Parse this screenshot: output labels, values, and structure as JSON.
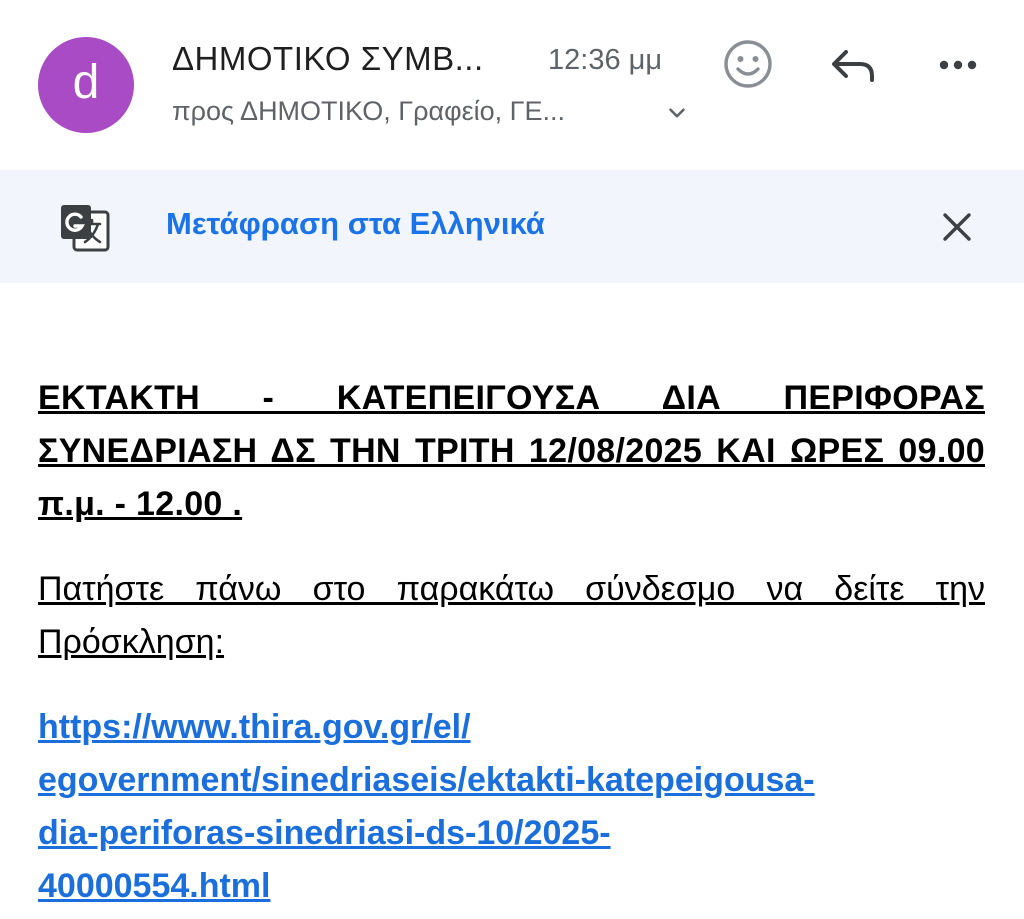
{
  "header": {
    "avatar_letter": "d",
    "avatar_color": "#a94bc4",
    "sender": "ΔΗΜΟΤΙΚΟ ΣΥΜΒ...",
    "time": "12:36 μμ",
    "recipients": "προς ΔΗΜΟΤΙΚΟ, Γραφείο, ΓΕ...",
    "icons": [
      "smiley-icon",
      "reply-icon",
      "more-icon",
      "chevron-down-icon"
    ]
  },
  "translate_bar": {
    "icon": "translate-icon",
    "label": "Μετάφραση στα Ελληνικά",
    "close_icon": "close-icon",
    "background": "#f2f6fc",
    "accent": "#1a73e8"
  },
  "message": {
    "subject": "ΕΚΤΑΚΤΗ - ΚΑΤΕΠΕΙΓΟΥΣΑ ΔΙΑ ΠΕΡΙΦΟΡΑΣ ΣΥΝΕΔΡΙΑΣΗ ΔΣ ΤΗΝ ΤΡΙΤΗ 12/08/2025 ΚΑΙ ΩΡΕΣ 09.00 π.μ. - 12.00 .",
    "instruction": "Πατήστε πάνω στο παρακάτω σύνδεσμο να δείτε την Πρόσκληση:",
    "link_lines": [
      "https://www.thira.gov.gr/el/",
      "egovernment/sinedriaseis/ektakti-katepeigousa-",
      "dia-periforas-sinedriasi-ds-10/2025-",
      "40000554.html"
    ]
  }
}
